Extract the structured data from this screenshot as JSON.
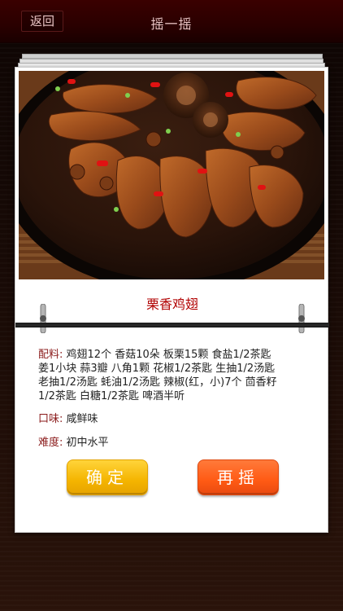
{
  "header": {
    "back_label": "返回",
    "title": "摇一摇"
  },
  "recipe": {
    "name": "栗香鸡翅",
    "ingredients_label": "配料:",
    "ingredients_lines": [
      "鸡翅12个 香菇10朵 板栗15颗 食盐1/2茶匙",
      "姜1小块 蒜3瓣 八角1颗 花椒1/2茶匙 生抽1/2汤匙",
      "老抽1/2汤匙 蚝油1/2汤匙 辣椒(红，小)7个 茴香籽",
      "1/2茶匙 白糖1/2茶匙 啤酒半听"
    ],
    "taste_label": "口味:",
    "taste_value": "咸鲜味",
    "difficulty_label": "难度:",
    "difficulty_value": "初中水平"
  },
  "buttons": {
    "confirm_label": "确定",
    "again_label": "再摇"
  },
  "colors": {
    "accent_red": "#b10000",
    "confirm_yellow": "#f4b400",
    "again_orange": "#ff5a14"
  }
}
